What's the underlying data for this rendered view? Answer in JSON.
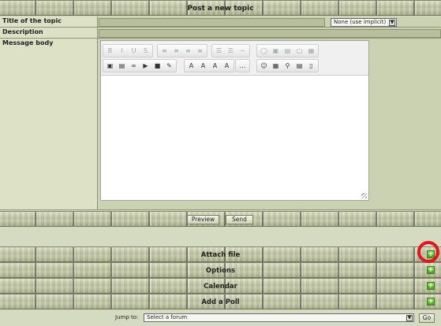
{
  "form": {
    "header": "Post a new topic",
    "title_label": "Title of the topic",
    "title_value": "",
    "icon_select": "None (use implicit)",
    "description_label": "Description",
    "description_value": "",
    "message_label": "Message body",
    "message_value": ""
  },
  "toolbar": {
    "row1": [
      {
        "name": "bold-icon",
        "glyph": "B"
      },
      {
        "name": "italic-icon",
        "glyph": "I"
      },
      {
        "name": "underline-icon",
        "glyph": "U"
      },
      {
        "name": "strikethrough-icon",
        "glyph": "S"
      },
      {
        "name": "align-left-icon",
        "glyph": "≡"
      },
      {
        "name": "align-center-icon",
        "glyph": "≡"
      },
      {
        "name": "align-right-icon",
        "glyph": "≡"
      },
      {
        "name": "align-justify-icon",
        "glyph": "≡"
      },
      {
        "name": "bullet-list-icon",
        "glyph": "☰"
      },
      {
        "name": "numbered-list-icon",
        "glyph": "☰"
      },
      {
        "name": "horizontal-rule-icon",
        "glyph": "─"
      },
      {
        "name": "comment-icon",
        "glyph": "◯"
      },
      {
        "name": "image-icon",
        "glyph": "▣"
      },
      {
        "name": "document-icon",
        "glyph": "▤"
      },
      {
        "name": "code-icon",
        "glyph": "▢"
      },
      {
        "name": "table-icon",
        "glyph": "▦"
      }
    ],
    "row2": [
      {
        "name": "insert-image-icon",
        "glyph": "▣"
      },
      {
        "name": "insert-media-icon",
        "glyph": "▤"
      },
      {
        "name": "link-icon",
        "glyph": "∞"
      },
      {
        "name": "youtube-icon",
        "glyph": "▶"
      },
      {
        "name": "flash-icon",
        "glyph": "■"
      },
      {
        "name": "pencil-icon",
        "glyph": "✎"
      },
      {
        "name": "font-size-icon",
        "glyph": "A"
      },
      {
        "name": "font-color-icon",
        "glyph": "A"
      },
      {
        "name": "font-face-icon",
        "glyph": "A"
      },
      {
        "name": "remove-format-icon",
        "glyph": "A"
      },
      {
        "name": "more-icon",
        "glyph": "…"
      },
      {
        "name": "smiley-icon",
        "glyph": "☺"
      },
      {
        "name": "calendar-icon",
        "glyph": "▦"
      },
      {
        "name": "search-icon",
        "glyph": "⚲"
      },
      {
        "name": "paste-icon",
        "glyph": "▤"
      },
      {
        "name": "page-icon",
        "glyph": "▯"
      }
    ]
  },
  "actions": {
    "preview": "Preview",
    "send": "Send"
  },
  "panels": [
    {
      "id": "attach",
      "label": "Attach file"
    },
    {
      "id": "options",
      "label": "Options"
    },
    {
      "id": "calendar",
      "label": "Calendar"
    },
    {
      "id": "poll",
      "label": "Add a Poll"
    }
  ],
  "plus_symbol": "+",
  "jump": {
    "label": "Jump to:",
    "select": "Select a forum",
    "go": "Go"
  },
  "colors": {
    "highlight_circle": "#e8121b",
    "plus_green": "#5cb52a"
  }
}
